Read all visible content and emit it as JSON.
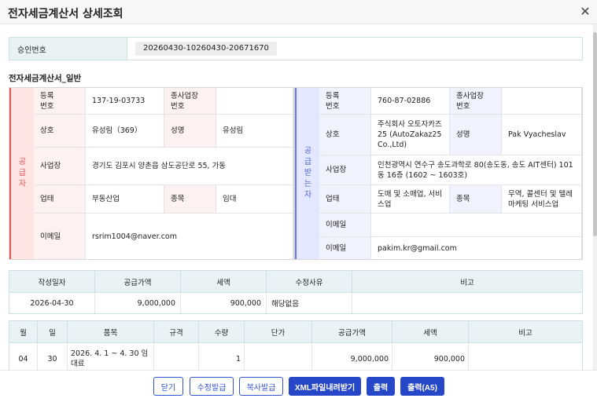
{
  "window": {
    "title": "전자세금계산서 상세조회",
    "close_icon": "close-icon"
  },
  "approval": {
    "label": "승인번호",
    "value": "20260430-10260430-20671670"
  },
  "section_title": "전자세금계산서_일반",
  "supplier": {
    "side_label": "공\n급\n자",
    "reg_no_label": "등록\n번호",
    "reg_no": "137-19-03733",
    "sub_biz_label": "종사업장\n번호",
    "sub_biz": "",
    "name_label": "상호",
    "name": "유성림（369）",
    "rep_label": "성명",
    "rep": "유성림",
    "addr_label": "사업장",
    "addr": "경기도 김포시 양촌읍 삼도공단로 55, 가동",
    "type_label": "업태",
    "type": "부동산업",
    "item_label": "종목",
    "item": "임대",
    "email_label": "이메일",
    "email": "rsrim1004@naver.com"
  },
  "buyer": {
    "side_label": "공\n급\n받\n는\n자",
    "reg_no_label": "등록\n번호",
    "reg_no": "760-87-02886",
    "sub_biz_label": "종사업장\n번호",
    "sub_biz": "",
    "name_label": "상호",
    "name": "주식회사 오토자카즈 25 (AutoZakaz25 Co.,Ltd)",
    "rep_label": "성명",
    "rep": "Pak Vyacheslav",
    "addr_label": "사업장",
    "addr": "인천광역시 연수구 송도과학로 80(송도동, 송도 AIT센터) 101동 16층 (1602 ~ 1603호)",
    "type_label": "업태",
    "type": "도매 및 소매업, 서비스업",
    "item_label": "종목",
    "item": "무역, 콜센터 및 텔레마케팅 서비스업",
    "email1_label": "이메일",
    "email1": "",
    "email2_label": "이메일",
    "email2": "pakim.kr@gmail.com"
  },
  "summary": {
    "headers": [
      "작성일자",
      "공급가액",
      "세액",
      "수정사유",
      "비고"
    ],
    "values": [
      "2026-04-30",
      "9,000,000",
      "900,000",
      "해당없음",
      ""
    ]
  },
  "items": {
    "headers": [
      "월",
      "일",
      "품목",
      "규격",
      "수량",
      "단가",
      "공급가액",
      "세액",
      "비고"
    ],
    "rows": [
      [
        "04",
        "30",
        "2026. 4. 1 ~ 4. 30 임대료",
        "",
        "1",
        "",
        "9,000,000",
        "900,000",
        ""
      ]
    ]
  },
  "buttons": {
    "close": "닫기",
    "revise": "수정발급",
    "copy": "복사발급",
    "xml": "XML파일내려받기",
    "print": "출력",
    "print_a5": "출력(A5)"
  },
  "colors": {
    "supplier_accent": "#e55a5a",
    "buyer_accent": "#6a7ae0",
    "button_primary": "#2647c8",
    "header_bg": "#e9f3f5"
  }
}
